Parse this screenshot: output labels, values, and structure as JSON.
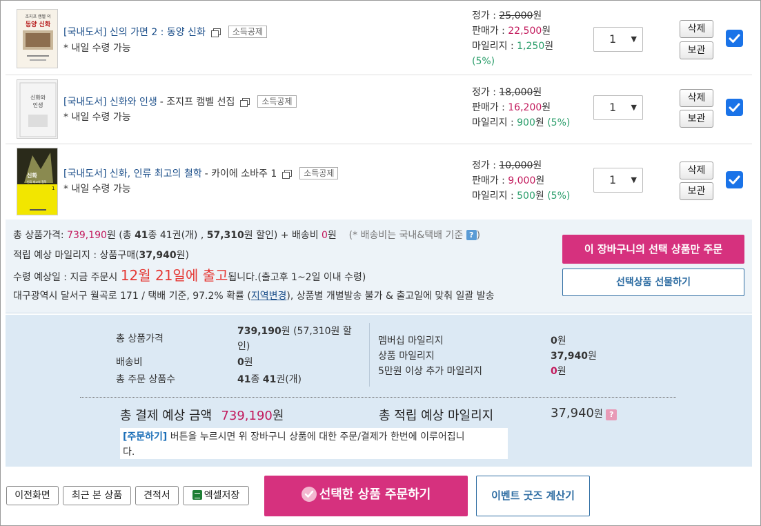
{
  "items": [
    {
      "category": "[국내도서]",
      "title": "신의 가면 2 : 동양 신화",
      "author": "",
      "tag": "소득공제",
      "delivery": "* 내일 수령 가능",
      "cover_text": [
        "조지프 캠벨 의",
        "동양 신화"
      ],
      "list_price_label": "정가 : ",
      "list_price": "25,000",
      "sale_price_label": "판매가 : ",
      "sale_price": "22,500",
      "mileage_label": "마일리지 : ",
      "mileage": "1,250",
      "mileage_rate": "(5%)",
      "won": "원",
      "qty": "1",
      "delete": "삭제",
      "keep": "보관",
      "checked": true
    },
    {
      "category": "[국내도서]",
      "title": "신화와 인생",
      "author": " - 조지프 캠벨 선집",
      "tag": "소득공제",
      "delivery": "* 내일 수령 가능",
      "cover_text": [
        "신화와",
        "인생"
      ],
      "list_price_label": "정가 : ",
      "list_price": "18,000",
      "sale_price_label": "판매가 : ",
      "sale_price": "16,200",
      "mileage_label": "마일리지 : ",
      "mileage": "900",
      "mileage_rate": "(5%)",
      "won": "원",
      "qty": "1",
      "delete": "삭제",
      "keep": "보관",
      "checked": true
    },
    {
      "category": "[국내도서]",
      "title": "신화, 인류 최고의 철학",
      "author": " - 카이에 소바주 1",
      "tag": "소득공제",
      "delivery": "* 내일 수령 가능",
      "cover_text": [
        "신화",
        "인류 최고의 철학",
        "1"
      ],
      "list_price_label": "정가 : ",
      "list_price": "10,000",
      "sale_price_label": "판매가 : ",
      "sale_price": "9,000",
      "mileage_label": "마일리지 : ",
      "mileage": "500",
      "mileage_rate": "(5%)",
      "won": "원",
      "qty": "1",
      "delete": "삭제",
      "keep": "보관",
      "checked": true
    }
  ],
  "cart_summary": {
    "total_label": "총 상품가격: ",
    "total_price": "739,190",
    "total_mid1": "원 (총 ",
    "kinds": "41",
    "total_mid2": "종 41권(개) , ",
    "discount": "57,310",
    "total_mid3": "원 할인) + 배송비 ",
    "shipping": "0",
    "total_mid4": "원",
    "shipping_note": "(* 배송비는 국내&택배 기준",
    "shipping_note_end": ")",
    "mileage_line_a": "적립 예상 마일리지 : 상품구매(",
    "mileage_value": "37,940",
    "mileage_line_b": "원)",
    "receive_a": "수령 예상일 : 지금 주문시 ",
    "receive_date": "12월 21일에 출고",
    "receive_b": "됩니다.(출고후 1~2일 이내 수령)",
    "addr_a": "대구광역시 달서구 월곡로 171 / 택배 기준, 97.2% 확률 (",
    "addr_link": "지역변경",
    "addr_b": "), 상품별 개별발송 불가 & 출고일에 맞춰 일괄 발송",
    "order_selected": "이 장바구니의 선택 상품만 주문",
    "gift_selected": "선택상품 선물하기"
  },
  "payment_summary": {
    "total_goods_label": "총 상품가격",
    "total_goods_value": "739,190",
    "total_goods_unit": "원 (57,310원 할",
    "total_goods_unit2": "인)",
    "shipping_label": "배송비",
    "shipping_value": "0",
    "shipping_unit": "원",
    "order_count_label": "총 주문 상품수",
    "order_count_value": "41",
    "order_count_mid": "종 ",
    "order_count_value2": "41",
    "order_count_unit": "권(개)",
    "membership_label": "멤버십 마일리지",
    "membership_value": "0",
    "membership_unit": "원",
    "goods_mileage_label": "상품 마일리지",
    "goods_mileage_value": "37,940",
    "goods_mileage_unit": "원",
    "extra_mileage_label": "5만원 이상 추가 마일리지",
    "extra_mileage_value": "0",
    "extra_mileage_unit": "원",
    "pay_total_label": "총 결제 예상 금액",
    "pay_total_value": "739,190",
    "pay_total_unit": "원",
    "earn_total_label": "총 적립 예상 마일리지",
    "earn_total_value": "37,940",
    "earn_total_unit": "원",
    "note_kw": "[주문하기]",
    "note_text": " 버튼을 누르시면 위 장바구니 상품에 대한 주문/결제가 한번에 이루어집니",
    "note_text2": "다."
  },
  "footer": {
    "prev": "이전화면",
    "recent": "최근 본 상품",
    "quote": "견적서",
    "excel": "엑셀저장",
    "order_main": "선택한 상품 주문하기",
    "event": "이벤트 굿즈 계산기"
  },
  "colors": {
    "accent_pink": "#d6317e",
    "link_blue": "#1c4f8a",
    "checkbox_blue": "#1a73e8",
    "mileage_green": "#2a9d6a",
    "summary_bg": "#dce9f4"
  }
}
